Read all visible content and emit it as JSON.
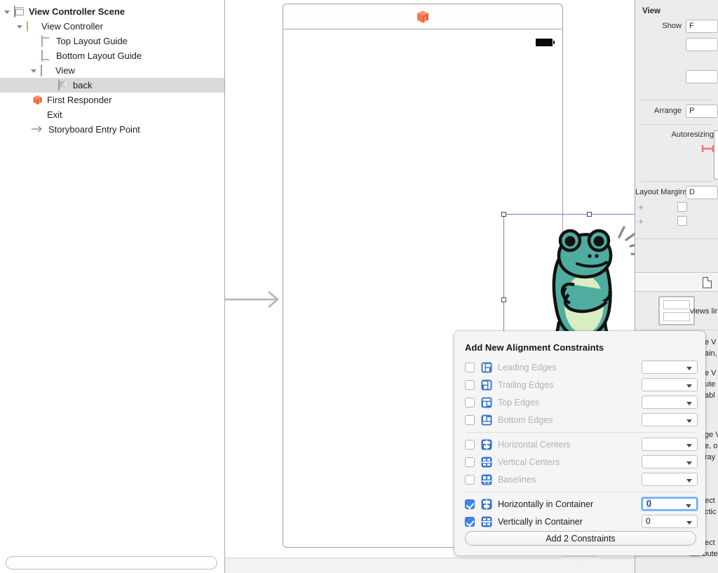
{
  "outline": {
    "rows": [
      {
        "label": "View Controller Scene",
        "icon": "scene-icon",
        "indent": 0,
        "twisty": "open",
        "bold": true,
        "selected": false
      },
      {
        "label": "View Controller",
        "icon": "view-controller-icon",
        "indent": 1,
        "twisty": "open",
        "bold": false,
        "selected": false
      },
      {
        "label": "Top Layout Guide",
        "icon": "top-layout-guide-icon",
        "indent": 2,
        "twisty": "none",
        "bold": false,
        "selected": false
      },
      {
        "label": "Bottom Layout Guide",
        "icon": "bottom-layout-guide-icon",
        "indent": 2,
        "twisty": "none",
        "bold": false,
        "selected": false
      },
      {
        "label": "View",
        "icon": "view-icon",
        "indent": 2,
        "twisty": "open",
        "bold": false,
        "selected": false
      },
      {
        "label": "back",
        "icon": "image-view-icon",
        "indent": 3,
        "twisty": "none",
        "bold": false,
        "selected": true
      },
      {
        "label": "First Responder",
        "icon": "first-responder-icon",
        "indent": 1,
        "twisty": "none",
        "bold": false,
        "selected": false
      },
      {
        "label": "Exit",
        "icon": "exit-icon",
        "indent": 1,
        "twisty": "none",
        "bold": false,
        "selected": false
      },
      {
        "label": "Storyboard Entry Point",
        "icon": "entry-point-arrow-icon",
        "indent": 1,
        "twisty": "none",
        "bold": false,
        "selected": false
      }
    ],
    "filter_placeholder": ""
  },
  "canvas": {
    "dock_icons": [
      "view-controller-icon",
      "first-responder-icon",
      "exit-icon"
    ],
    "selected_element": "back",
    "artwork": "frog-illustration"
  },
  "inspector": {
    "title": "View",
    "rows": [
      {
        "label": "Show",
        "value": "F"
      },
      {
        "label": "",
        "value": ""
      },
      {
        "label": "",
        "value": ""
      },
      {
        "label": "Arrange",
        "value": "P"
      },
      {
        "label": "Autoresizing",
        "value": ""
      },
      {
        "label": "Layout Margins",
        "value": "D"
      }
    ],
    "show_label": "Show",
    "show_value": "F",
    "arrange_label": "Arrange",
    "arrange_value": "P",
    "autoresizing_label": "Autoresizing",
    "layout_margins_label": "Layout Margins",
    "layout_margins_value": "D",
    "plus_label": "+",
    "library": [
      {
        "title_clipped": "views lir",
        "head": "",
        "sub": "views lir"
      },
      {
        "head": "e V",
        "sub": "ain,"
      },
      {
        "head": "e V",
        "sub": "ute"
      },
      {
        "head": "",
        "sub": "abl"
      },
      {
        "head": "ge V",
        "sub": "e, o"
      },
      {
        "head": "",
        "sub": "ray"
      },
      {
        "head": "ect",
        "sub": "ctic"
      },
      {
        "head": "ect",
        "sub": "attribute"
      }
    ]
  },
  "popover": {
    "title": "Add New Alignment Constraints",
    "constraints": [
      {
        "label": "Leading Edges",
        "icon": "align-leading-edges-icon",
        "checked": false,
        "value": "",
        "focused": false
      },
      {
        "label": "Trailing Edges",
        "icon": "align-trailing-edges-icon",
        "checked": false,
        "value": "",
        "focused": false
      },
      {
        "label": "Top Edges",
        "icon": "align-top-edges-icon",
        "checked": false,
        "value": "",
        "focused": false
      },
      {
        "label": "Bottom Edges",
        "icon": "align-bottom-edges-icon",
        "checked": false,
        "value": "",
        "focused": false
      },
      {
        "label": "Horizontal Centers",
        "icon": "align-horizontal-centers-icon",
        "checked": false,
        "value": "",
        "focused": false
      },
      {
        "label": "Vertical Centers",
        "icon": "align-vertical-centers-icon",
        "checked": false,
        "value": "",
        "focused": false
      },
      {
        "label": "Baselines",
        "icon": "align-baselines-icon",
        "checked": false,
        "value": "",
        "focused": false
      },
      {
        "label": "Horizontally in Container",
        "icon": "center-horizontally-icon",
        "checked": true,
        "value": "0",
        "focused": true
      },
      {
        "label": "Vertically in Container",
        "icon": "center-vertically-icon",
        "checked": true,
        "value": "0",
        "focused": false
      }
    ],
    "add_button_label": "Add 2 Constraints"
  },
  "colors": {
    "accent_blue": "#3c86f0",
    "icon_blue": "#3a76c8",
    "selection_gray": "#d9d9d9",
    "selection_outline": "#6f7fd6",
    "vc_yellow": "#f5c518",
    "exit_orange": "#f4744a",
    "frog_green": "#4fada0",
    "frog_belly": "#d8eec2",
    "autoresize_red": "#f4716e",
    "inspector_bg": "#ececec"
  }
}
